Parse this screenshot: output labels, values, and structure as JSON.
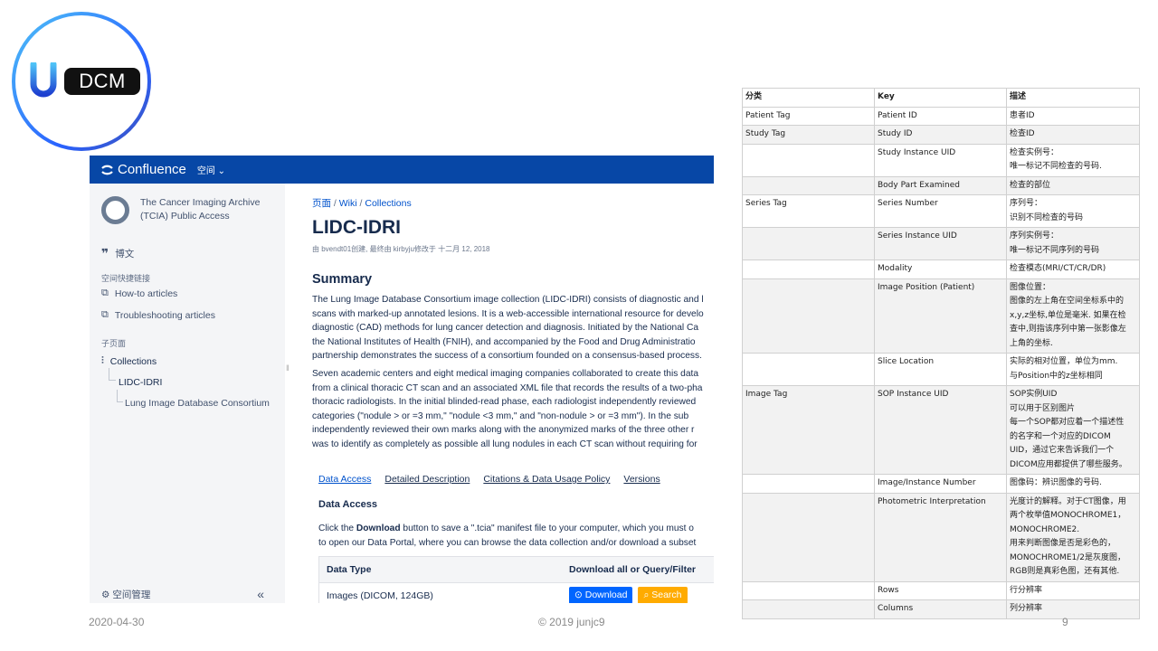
{
  "logo": {
    "text": "DCM"
  },
  "confluence": {
    "app_name": "Confluence",
    "space_menu": "空间 ⌄",
    "sidebar": {
      "space_name_1": "The Cancer Imaging Archive",
      "space_name_2": "(TCIA) Public Access",
      "blog_label": "博文",
      "shortcuts_heading": "空间快捷链接",
      "shortcuts": [
        "How-to articles",
        "Troubleshooting articles"
      ],
      "children_heading": "子页面",
      "tree": [
        "Collections",
        "LIDC-IDRI",
        "Lung Image Database Consortium"
      ],
      "space_admin": "空间管理",
      "collapse": "«"
    },
    "breadcrumb": [
      "页面",
      "Wiki",
      "Collections"
    ],
    "page_title": "LIDC-IDRI",
    "page_meta": "由 bvendt01创建, 最终由 kirbyju修改于 十二月 12, 2018",
    "summary_heading": "Summary",
    "summary_lines": [
      "The Lung Image Database Consortium image collection (LIDC-IDRI) consists of diagnostic and l",
      "scans with marked-up annotated lesions. It is a web-accessible international resource for develo",
      "diagnostic (CAD) methods for lung cancer detection and diagnosis. Initiated by the National Ca",
      "the National Institutes of Health (FNIH), and accompanied by the Food and Drug Administratio",
      "partnership demonstrates the success of a consortium founded on a consensus-based process."
    ],
    "para2_lines": [
      "Seven academic centers and eight medical imaging companies collaborated to create this data",
      "from a clinical thoracic CT scan and an associated XML file that records the results of a two-pha",
      "thoracic radiologists. In the initial blinded-read phase, each radiologist independently reviewed",
      "categories (\"nodule > or =3 mm,\" \"nodule <3 mm,\" and \"non-nodule > or =3 mm\"). In the sub",
      "independently reviewed their own marks along with the anonymized marks of the three other r",
      "was to identify as completely as possible all lung nodules in each CT scan without requiring for"
    ],
    "tabs": [
      "Data Access",
      "Detailed Description",
      "Citations & Data Usage Policy",
      "Versions"
    ],
    "data_access_heading": "Data Access",
    "data_access_line1_pre": "Click the ",
    "data_access_line1_bold": "Download",
    "data_access_line1_post": " button to save a \".tcia\" manifest file to your computer, which you must o",
    "data_access_line2": "to open our Data Portal, where you can browse the data collection and/or download a subset",
    "data_table": {
      "headers": [
        "Data Type",
        "Download all or Query/Filter"
      ],
      "row_type": "Images (DICOM, 124GB)",
      "download_btn": "Download",
      "search_btn": "Search"
    }
  },
  "tag_table": {
    "headers": [
      "分类",
      "Key",
      "描述"
    ],
    "rows": [
      {
        "cat": "Patient Tag",
        "key": "Patient ID",
        "desc": [
          "患者ID"
        ]
      },
      {
        "cat": "Study Tag",
        "key": "Study ID",
        "desc": [
          "检查ID"
        ]
      },
      {
        "cat": "",
        "key": "Study Instance UID",
        "desc": [
          "检查实例号：",
          "唯一标记不同检查的号码."
        ]
      },
      {
        "cat": "",
        "key": "Body Part Examined",
        "desc": [
          "检查的部位"
        ]
      },
      {
        "cat": "Series Tag",
        "key": "Series Number",
        "desc": [
          "序列号：",
          "识别不同检查的号码"
        ]
      },
      {
        "cat": "",
        "key": "Series Instance UID",
        "desc": [
          "序列实例号：",
          "唯一标记不同序列的号码"
        ]
      },
      {
        "cat": "",
        "key": "Modality",
        "desc": [
          "检查模态(MRI/CT/CR/DR)"
        ]
      },
      {
        "cat": "",
        "key": "Image Position (Patient)",
        "desc": [
          "图像位置：",
          "图像的左上角在空间坐标系中的",
          "x,y,z坐标,单位是毫米. 如果在检",
          "查中,则指该序列中第一张影像左",
          "上角的坐标."
        ]
      },
      {
        "cat": "",
        "key": "Slice Location",
        "desc": [
          "实际的相对位置，单位为mm.",
          "与Position中的z坐标相同"
        ]
      },
      {
        "cat": "Image Tag",
        "key": "SOP Instance UID",
        "desc": [
          "SOP实例UID",
          "可以用于区别图片",
          "每一个SOP都对应着一个描述性",
          "的名字和一个对应的DICOM",
          "UID，通过它来告诉我们一个",
          "DICOM应用都提供了哪些服务。"
        ]
      },
      {
        "cat": "",
        "key": "Image/Instance Number",
        "desc": [
          "图像码：辨识图像的号码."
        ]
      },
      {
        "cat": "",
        "key": "Photometric Interpretation",
        "desc": [
          "光度计的解释。对于CT图像，用",
          "两个枚举值MONOCHROME1，",
          "MONOCHROME2.",
          "用来判断图像是否是彩色的，",
          "MONOCHROME1/2是灰度图，",
          "RGB则是真彩色图，还有其他."
        ]
      },
      {
        "cat": "",
        "key": "Rows",
        "desc": [
          "行分辨率"
        ]
      },
      {
        "cat": "",
        "key": "Columns",
        "desc": [
          "列分辨率"
        ]
      }
    ]
  },
  "footer": {
    "date": "2020-04-30",
    "copyright": "© 2019 junjc9",
    "page": "9"
  }
}
